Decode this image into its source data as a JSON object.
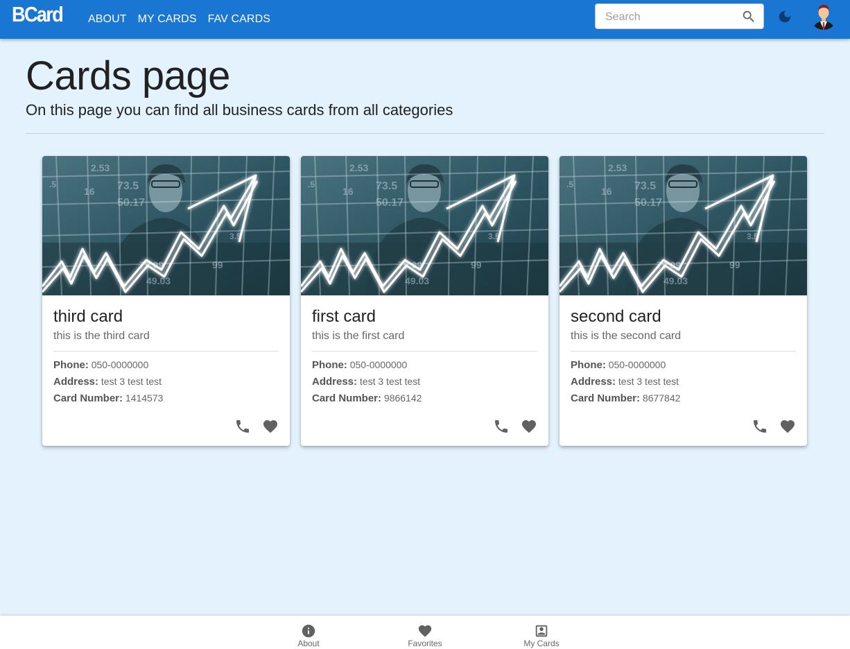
{
  "appbar": {
    "logo": "BCard",
    "nav": [
      "ABOUT",
      "MY CARDS",
      "FAV CARDS"
    ],
    "search_placeholder": "Search",
    "primary_color": "#1976d2"
  },
  "header": {
    "title": "Cards page",
    "subtitle": "On this page you can find all business cards from all categories"
  },
  "cards": [
    {
      "title": "third card",
      "subtitle": "this is the third card",
      "phone_label": "Phone:",
      "phone": "050-0000000",
      "address_label": "Address:",
      "address": "test 3 test test",
      "number_label": "Card Number:",
      "number": "1414573"
    },
    {
      "title": "first card",
      "subtitle": "this is the first card",
      "phone_label": "Phone:",
      "phone": "050-0000000",
      "address_label": "Address:",
      "address": "test 3 test test",
      "number_label": "Card Number:",
      "number": "9866142"
    },
    {
      "title": "second card",
      "subtitle": "this is the second card",
      "phone_label": "Phone:",
      "phone": "050-0000000",
      "address_label": "Address:",
      "address": "test 3 test test",
      "number_label": "Card Number:",
      "number": "8677842"
    }
  ],
  "bottom_nav": [
    {
      "label": "About",
      "icon": "info-icon"
    },
    {
      "label": "Favorites",
      "icon": "heart-icon"
    },
    {
      "label": "My Cards",
      "icon": "contact-card-icon"
    }
  ],
  "colors": {
    "background": "#e3f2fd",
    "icon_gray": "#616161"
  }
}
